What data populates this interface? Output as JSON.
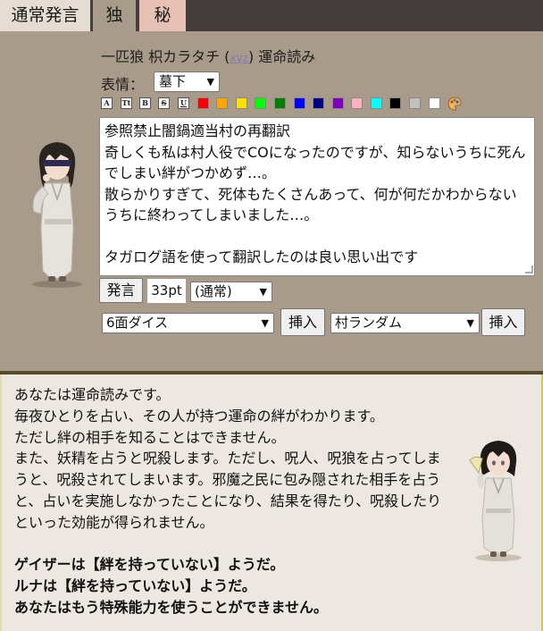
{
  "tabs": [
    {
      "label": "通常発言"
    },
    {
      "label": "独"
    },
    {
      "label": "秘"
    }
  ],
  "header": {
    "name_prefix": "一匹狼 枳カラタチ (",
    "name_link": "xyz",
    "name_suffix": ") 運命読み"
  },
  "expression": {
    "label": "表情：",
    "value": "墓下"
  },
  "format_buttons": [
    "A",
    "Tt",
    "B",
    "S",
    "U"
  ],
  "color_swatches": [
    "#ff0000",
    "#ffa500",
    "#ffe000",
    "#00ff00",
    "#008000",
    "#0000ff",
    "#000080",
    "#8000c0",
    "#ffb0c0",
    "#00ffff",
    "#000000",
    "#c0c0c0",
    "#ffffff"
  ],
  "message": {
    "text": "参照禁止闇鍋適当村の再翻訳\n奇しくも私は村人役でCOになったのですが、知らないうちに死んでしまい絆がつかめず…。\n散らかりすぎて、死体もたくさんあって、何が何だかわからないうちに終わってしまいました…。\n\nタガログ語を使って翻訳したのは良い思い出です"
  },
  "controls": {
    "speak_label": "発言",
    "size_value": "33pt",
    "mode_value": "(通常)",
    "dice_value": "6面ダイス",
    "insert_label": "挿入",
    "random_value": "村ランダム",
    "insert2_label": "挿入"
  },
  "role": {
    "paragraph": [
      "あなたは運命読みです。",
      "毎夜ひとりを占い、その人が持つ運命の絆がわかります。",
      "ただし絆の相手を知ることはできません。",
      "また、妖精を占うと呪殺します。ただし、呪人、呪狼を占ってしまうと、呪殺されてしまいます。邪魔之民に包み隠された相手を占うと、占いを実施しなかったことになり、結果を得たり、呪殺したりといった効能が得られません。"
    ],
    "results": [
      "ゲイザーは【絆を持っていない】ようだ。",
      "ルナは【絆を持っていない】ようだ。",
      "あなたはもう特殊能力を使うことができません。"
    ]
  }
}
